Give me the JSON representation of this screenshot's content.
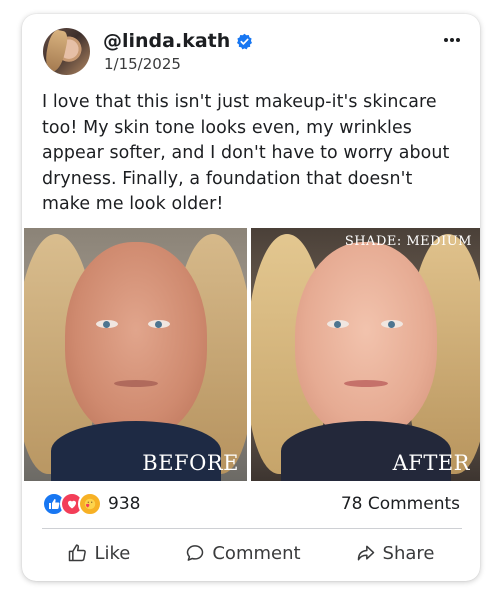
{
  "post": {
    "username": "@linda.kath",
    "date": "1/15/2025",
    "caption": "I love that this isn't just makeup-it's skincare too! My skin tone looks even, my wrinkles appear softer, and I don't have to worry about dryness. Finally, a foundation that doesn't make me look older!"
  },
  "photos": {
    "before_label": "BEFORE",
    "after_label": "AFTER",
    "shade_label": "SHADE: MEDIUM"
  },
  "stats": {
    "reaction_count": "938",
    "comments": "78 Comments"
  },
  "actions": {
    "like": "Like",
    "comment": "Comment",
    "share": "Share"
  },
  "icons": [
    "verified-badge-icon",
    "more-options-icon",
    "like-reaction-icon",
    "love-reaction-icon",
    "care-reaction-icon",
    "thumbs-up-icon",
    "comment-icon",
    "share-icon"
  ],
  "colors": {
    "accent": "#1877f2",
    "love": "#f33e58",
    "care": "#f7b125",
    "text": "#1c1e21"
  }
}
